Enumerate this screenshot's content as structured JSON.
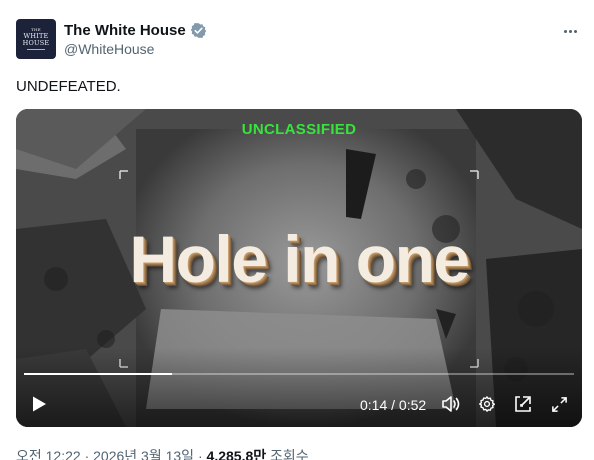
{
  "account": {
    "display_name": "The White House",
    "handle": "@WhiteHouse",
    "avatar_text": {
      "the": "THE",
      "line1": "WHITE",
      "line2": "HOUSE"
    },
    "verified_badge_color": "#829aab"
  },
  "post": {
    "text": "UNDEFEATED."
  },
  "video": {
    "classification_label": "UNCLASSIFIED",
    "overlay_title": "Hole in one",
    "progress": 0.269,
    "time_display": "0:14 / 0:52"
  },
  "footer": {
    "time": "오전 12:22",
    "separator1": " · ",
    "date": "2026년 3월 13일",
    "separator2": " · ",
    "views_count": "4,285.8만",
    "views_label": " 조회수"
  },
  "colors": {
    "label_green": "#38e33d",
    "avatar_bg": "#1b2239",
    "muted_text": "#536471"
  },
  "icons": [
    "verified-badge-icon",
    "more-icon",
    "play-icon",
    "volume-icon",
    "settings-icon",
    "picture-in-picture-icon",
    "fullscreen-icon"
  ]
}
